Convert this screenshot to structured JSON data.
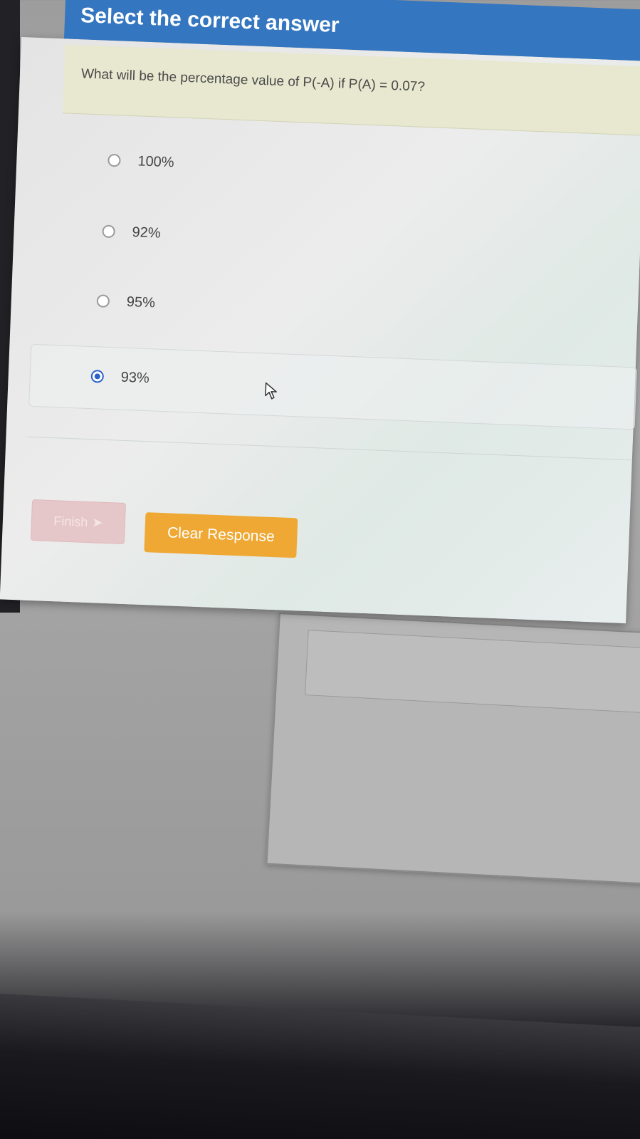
{
  "header": {
    "title": "Select the correct answer"
  },
  "question": {
    "text": "What will be the percentage value of P(-A) if P(A) = 0.07?"
  },
  "options": [
    {
      "label": "100%",
      "selected": false
    },
    {
      "label": "92%",
      "selected": false
    },
    {
      "label": "95%",
      "selected": false
    },
    {
      "label": "93%",
      "selected": true
    }
  ],
  "buttons": {
    "finish_label": "Finish",
    "clear_label": "Clear Response"
  },
  "colors": {
    "header": "#3476c0",
    "question_bg": "#e7e8cf",
    "clear_button": "#efa834",
    "finish_button": "#e6c7c9",
    "radio_selected": "#2a62c8"
  },
  "icons": {
    "finish": "arrow-right-icon",
    "cursor": "mouse-pointer-icon"
  }
}
